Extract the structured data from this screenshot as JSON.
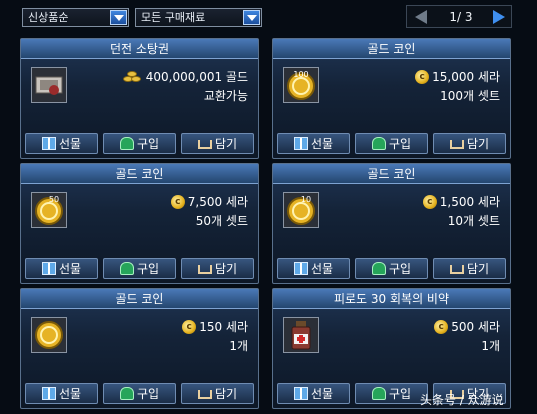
{
  "filters": {
    "sort": "신상품순",
    "category": "모든 구매재료"
  },
  "pager": {
    "text": "1/ 3"
  },
  "buttons": {
    "gift": "선물",
    "buy": "구입",
    "cart": "담기"
  },
  "items": [
    {
      "title": "던전 소탕권",
      "price": "400,000,001 골드",
      "sub": "교환가능",
      "icon": "ticket-icon"
    },
    {
      "title": "골드 코인",
      "price": "15,000 세라",
      "sub": "100개 셋트",
      "icon": "gold-coin-icon",
      "badge": "100"
    },
    {
      "title": "골드 코인",
      "price": "7,500 세라",
      "sub": "50개 셋트",
      "icon": "gold-coin-icon",
      "badge": "50"
    },
    {
      "title": "골드 코인",
      "price": "1,500 세라",
      "sub": "10개 셋트",
      "icon": "gold-coin-icon",
      "badge": "10"
    },
    {
      "title": "골드 코인",
      "price": "150 세라",
      "sub": "1개",
      "icon": "gold-coin-icon"
    },
    {
      "title": "피로도 30 회복의 비약",
      "price": "500 세라",
      "sub": "1개",
      "icon": "potion-icon"
    }
  ],
  "watermark": "头条号 / 众游说",
  "colors": {
    "accent": "#3f8ff0",
    "card_title": "#4a79b8"
  }
}
